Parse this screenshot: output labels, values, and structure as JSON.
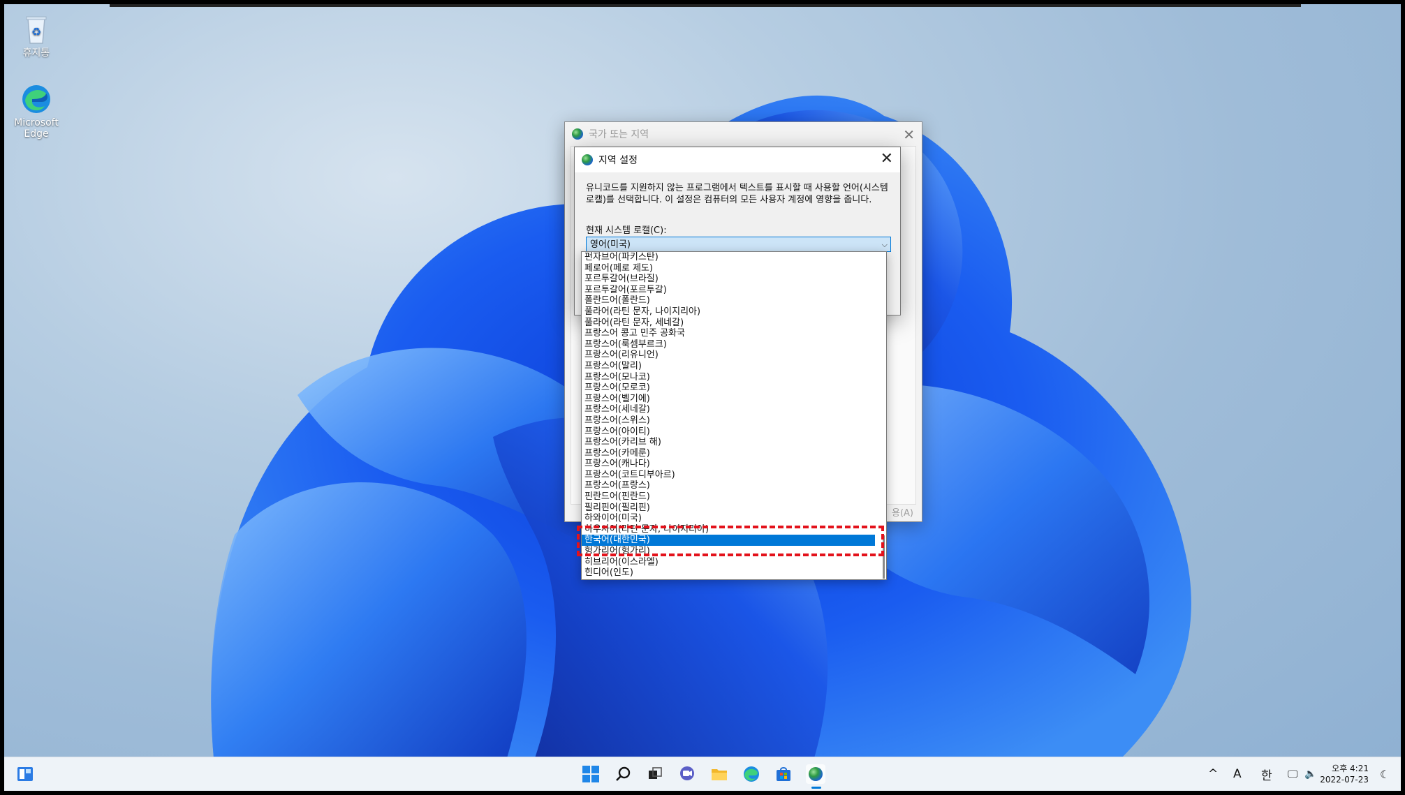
{
  "desktop": {
    "icons": [
      {
        "label": "휴지통"
      },
      {
        "label": "Microsoft Edge"
      }
    ]
  },
  "back_dialog": {
    "title": "국가 또는 지역",
    "apply_label": "용(A)"
  },
  "dialog": {
    "title": "지역 설정",
    "description": "유니코드를 지원하지 않는 프로그램에서 텍스트를 표시할 때 사용할 언어(시스템 로캘)를 선택합니다. 이 설정은 컴퓨터의 모든 사용자 계정에 영향을 줍니다.",
    "locale_label": "현재 시스템 로캘(C):",
    "locale_value": "영어(미국)"
  },
  "dropdown": {
    "items": [
      "펀자브어(파키스탄)",
      "페로어(페로 제도)",
      "포르투갈어(브라질)",
      "포르투갈어(포르투갈)",
      "폴란드어(폴란드)",
      "풀라어(라틴 문자, 나이지리아)",
      "풀라어(라틴 문자, 세네갈)",
      "프랑스어 콩고 민주 공화국",
      "프랑스어(룩셈부르크)",
      "프랑스어(리유니언)",
      "프랑스어(말리)",
      "프랑스어(모나코)",
      "프랑스어(모로코)",
      "프랑스어(벨기에)",
      "프랑스어(세네갈)",
      "프랑스어(스위스)",
      "프랑스어(아이티)",
      "프랑스어(카리브 해)",
      "프랑스어(카메룬)",
      "프랑스어(캐나다)",
      "프랑스어(코트디부아르)",
      "프랑스어(프랑스)",
      "핀란드어(핀란드)",
      "필리핀어(필리핀)",
      "하와이어(미국)",
      "하우사어(라틴 문자, 나이지리아)",
      "한국어(대한민국)",
      "헝가리어(헝가리)",
      "히브리어(이스라엘)",
      "힌디어(인도)"
    ],
    "selected_index": 26
  },
  "taskbar": {
    "tray": {
      "chevron": "^",
      "ime_mode": "A",
      "ime_lang": "한"
    },
    "clock": {
      "time": "오후 4:21",
      "date": "2022-07-23"
    }
  },
  "colors": {
    "accent": "#0078d7",
    "highlight": "#e3121b"
  }
}
